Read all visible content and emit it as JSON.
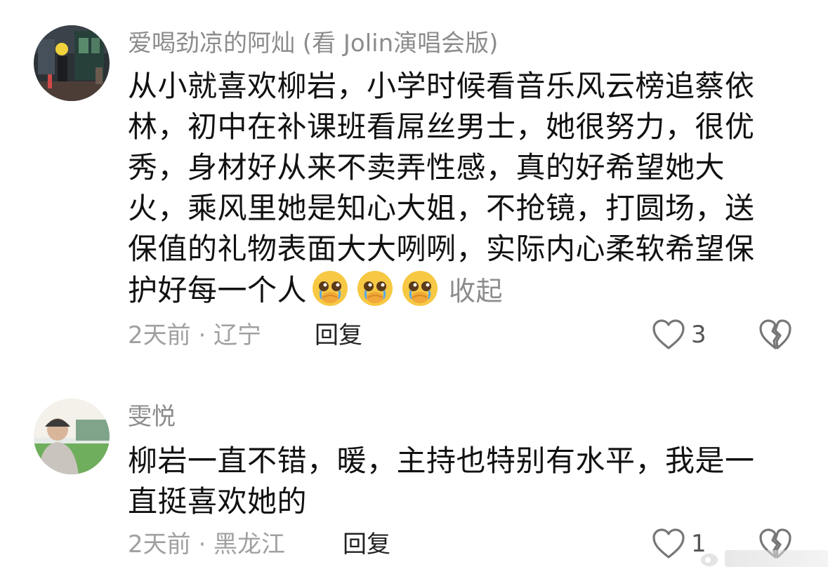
{
  "comments": [
    {
      "username": "爱喝劲凉的阿灿 (看 Jolin演唱会版)",
      "text": "从小就喜欢柳岩，小学时候看音乐风云榜追蔡依林，初中在补课班看屌丝男士，她很努力，很优秀，身材好从来不卖弄性感，真的好希望她大火，乘风里她是知心大姐，不抢镜，打圆场，送保值的礼物表面大大咧咧，实际内心柔软希望保护好每一个人",
      "emojis": [
        "pleading-face-icon",
        "pleading-face-icon",
        "pleading-face-icon"
      ],
      "collapse_label": "收起",
      "time_location": "2天前 · 辽宁",
      "reply_label": "回复",
      "like_count": "3"
    },
    {
      "username": "雯悦",
      "text": "柳岩一直不错，暖，主持也特别有水平，我是一直挺喜欢她的",
      "time_location": "2天前 · 黑龙江",
      "reply_label": "回复",
      "like_count": "1"
    }
  ],
  "colors": {
    "username": "#8c8c8c",
    "text": "#111111",
    "meta": "#a0a0a0",
    "icon_stroke": "#777777",
    "emoji_face": "#f7c843"
  }
}
